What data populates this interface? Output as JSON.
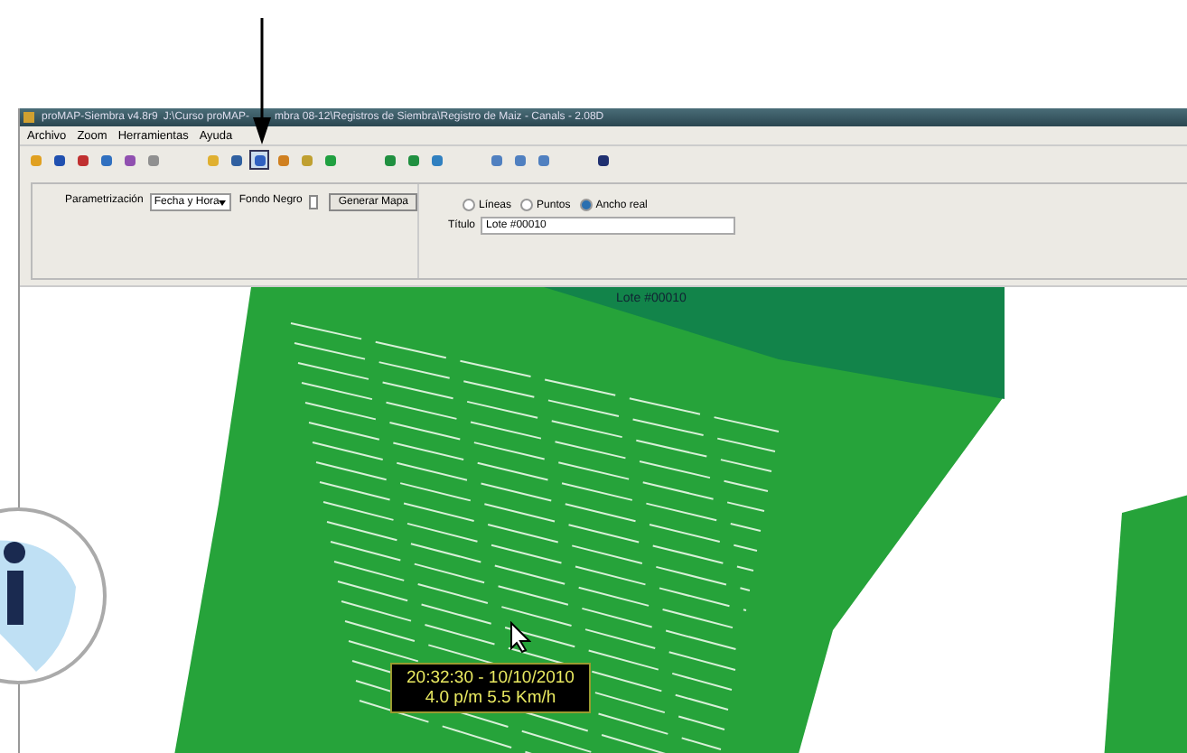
{
  "window": {
    "title": "proMAP-Siembra v4.8r9",
    "path_parts": [
      "J:\\Curso proMAP-",
      "mbra 08-12\\Registros de Siembra\\Registro de Maiz - Canals - 2.08D"
    ]
  },
  "menu": [
    "Archivo",
    "Zoom",
    "Herramientas",
    "Ayuda"
  ],
  "toolbar": [
    {
      "selected": false
    },
    {
      "selected": false
    },
    {
      "selected": false
    },
    {
      "selected": false
    },
    {
      "selected": false
    },
    {
      "selected": false
    },
    {
      "selected": false
    },
    {
      "selected": false
    },
    {
      "selected": true
    },
    {
      "selected": false
    },
    {
      "selected": false
    },
    {
      "selected": false
    },
    {
      "selected": false
    },
    {
      "selected": false
    },
    {
      "selected": false
    },
    {
      "selected": false
    },
    {
      "selected": false
    },
    {
      "selected": false
    },
    {
      "selected": false
    }
  ],
  "panel": {
    "param_label": "Parametrización",
    "param_value": "Fecha y Hora",
    "fondo_label": "Fondo Negro",
    "fondo_checked": false,
    "button": "Generar Mapa",
    "modes": [
      {
        "label": "Líneas",
        "selected": false
      },
      {
        "label": "Puntos",
        "selected": false
      },
      {
        "label": "Ancho real",
        "selected": true
      }
    ],
    "title_label": "Título",
    "title_value": "Lote #00010"
  },
  "map": {
    "label": "Lote #00010",
    "tooltip": [
      "20:32:30 - 10/10/2010",
      "4.0 p/m 5.5 Km/h"
    ]
  }
}
